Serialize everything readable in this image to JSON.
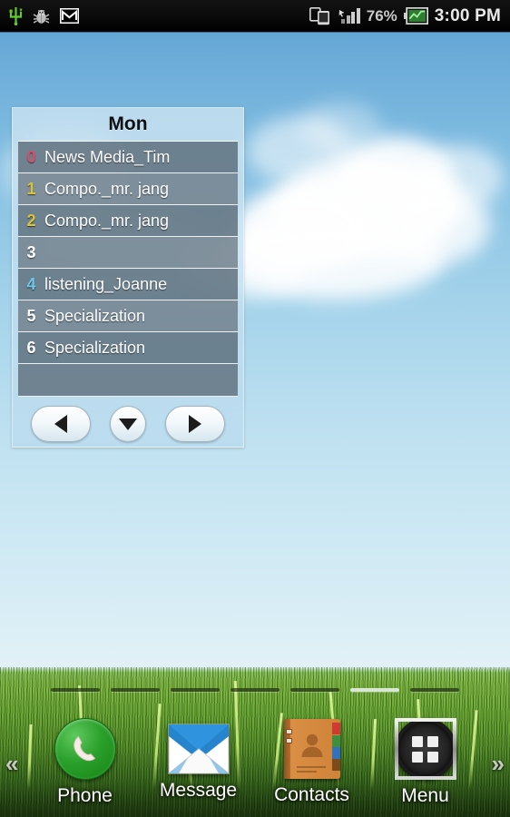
{
  "status_bar": {
    "left_icons": [
      {
        "name": "usb-icon",
        "glyph": "usb"
      },
      {
        "name": "bug-icon",
        "glyph": "bug"
      },
      {
        "name": "gmail-icon",
        "glyph": "M"
      }
    ],
    "right": {
      "screen_mirror_icon": "screen-share-icon",
      "signal_icon": "signal-bars-icon",
      "battery_percent": "76%",
      "battery_icon": "battery-icon",
      "clock": "3:00 PM"
    }
  },
  "widget": {
    "title": "Mon",
    "rows": [
      {
        "index": "0",
        "label": "News Media_Tim",
        "index_color": "#d4526e"
      },
      {
        "index": "1",
        "label": "Compo._mr. jang",
        "index_color": "#d8c33a"
      },
      {
        "index": "2",
        "label": "Compo._mr. jang",
        "index_color": "#d8c33a"
      },
      {
        "index": "3",
        "label": "",
        "index_color": "#ffffff"
      },
      {
        "index": "4",
        "label": "listening_Joanne",
        "index_color": "#6fc7e8"
      },
      {
        "index": "5",
        "label": "Specialization",
        "index_color": "#ffffff"
      },
      {
        "index": "6",
        "label": "Specialization",
        "index_color": "#ffffff"
      },
      {
        "index": "",
        "label": "",
        "index_color": "#ffffff"
      }
    ],
    "nav": [
      {
        "name": "prev-button",
        "icon": "triangle-left-icon"
      },
      {
        "name": "down-button",
        "icon": "triangle-down-icon"
      },
      {
        "name": "next-button",
        "icon": "triangle-right-icon"
      }
    ]
  },
  "home": {
    "page_indicator": {
      "count": 7,
      "active_index": 5
    },
    "scroll_left_glyph": "«",
    "scroll_right_glyph": "»"
  },
  "dock": [
    {
      "label": "Phone",
      "icon": "phone-icon"
    },
    {
      "label": "Message",
      "icon": "message-icon"
    },
    {
      "label": "Contacts",
      "icon": "contacts-icon"
    },
    {
      "label": "Menu",
      "icon": "app-drawer-icon"
    }
  ],
  "colors": {
    "sky_top": "#5a9fd0",
    "sky_bottom": "#e2f1f7",
    "grass": "#6aa634",
    "widget_bg": "#cde4f2",
    "row_bg": "#3c4854",
    "status_bar": "#000000"
  }
}
